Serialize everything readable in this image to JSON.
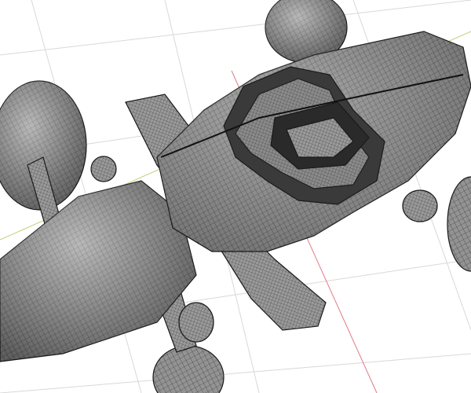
{
  "viewport": {
    "mode": "wireframe-overlay",
    "background_color": "#ffffff",
    "grid_color": "#d6d6d6",
    "x_axis_color": "#e07a86",
    "y_axis_color": "#b9d27a",
    "mesh_fill_color": "#8f8f8f",
    "mesh_wire_color": "#2a2a2a"
  },
  "model": {
    "parts": [
      "main-body",
      "cockpit",
      "front-wing",
      "rear-pod",
      "wheel-top",
      "wheel-left",
      "wheel-bottom",
      "wheel-right"
    ]
  }
}
